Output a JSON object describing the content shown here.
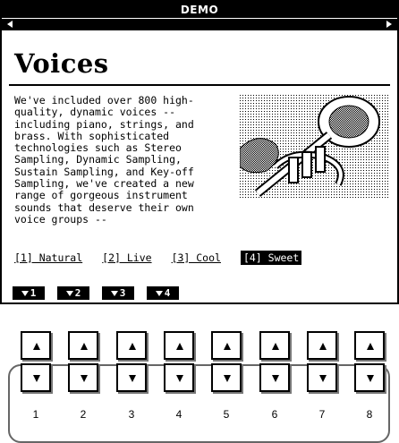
{
  "screen": {
    "title": "DEMO",
    "heading": "Voices",
    "body": "We've included over 800 high-\nquality, dynamic voices --\nincluding piano, strings, and\nbrass. With sophisticated\ntechnologies such as Stereo\nSampling, Dynamic Sampling,\nSustain Sampling, and Key-off\nSampling, we've created a new\nrange of gorgeous instrument\nsounds that deserve their own\nvoice groups --",
    "links": [
      {
        "label": "[1] Natural",
        "active": false
      },
      {
        "label": "[2] Live",
        "active": false
      },
      {
        "label": "[3] Cool",
        "active": false
      },
      {
        "label": "[4] Sweet",
        "active": true
      }
    ],
    "softkeys": [
      "1",
      "2",
      "3",
      "4"
    ]
  },
  "panel": {
    "button_numbers": [
      "1",
      "2",
      "3",
      "4",
      "5",
      "6",
      "7",
      "8"
    ]
  }
}
